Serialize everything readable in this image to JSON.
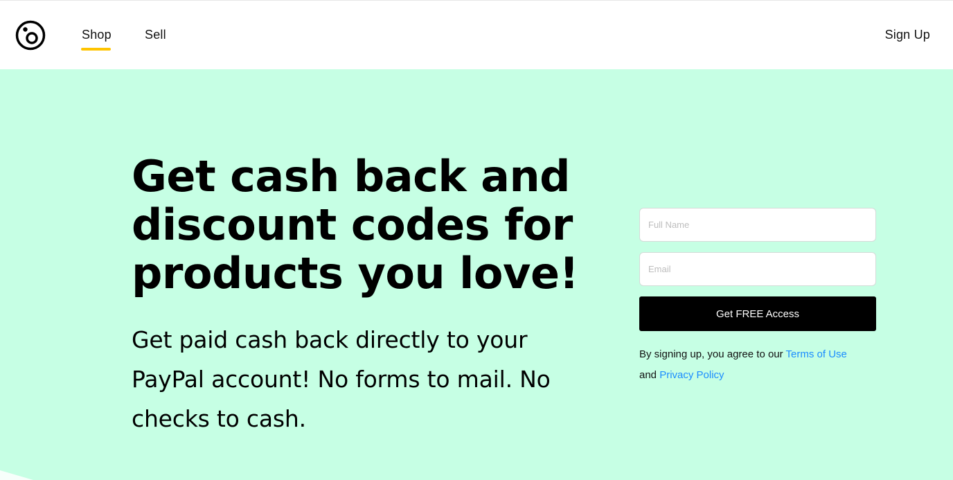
{
  "header": {
    "logo_icon": "dot-o-logo-icon",
    "nav": [
      {
        "label": "Shop",
        "active": true
      },
      {
        "label": "Sell",
        "active": false
      }
    ],
    "signup_label": "Sign Up",
    "active_underline_color": "#ffc400"
  },
  "hero": {
    "background_color": "#c6ffe4",
    "headline": "Get cash back and discount codes for products you love!",
    "subtext": "Get paid cash back directly to your PayPal account! No forms to mail. No checks to cash."
  },
  "form": {
    "name_placeholder": "Full Name",
    "email_placeholder": "Email",
    "submit_label": "Get FREE Access",
    "legal_prefix": "By signing up, you agree to our ",
    "terms_label": "Terms of Use",
    "legal_and": "and ",
    "privacy_label": "Privacy Policy",
    "link_color": "#1a8cff"
  }
}
